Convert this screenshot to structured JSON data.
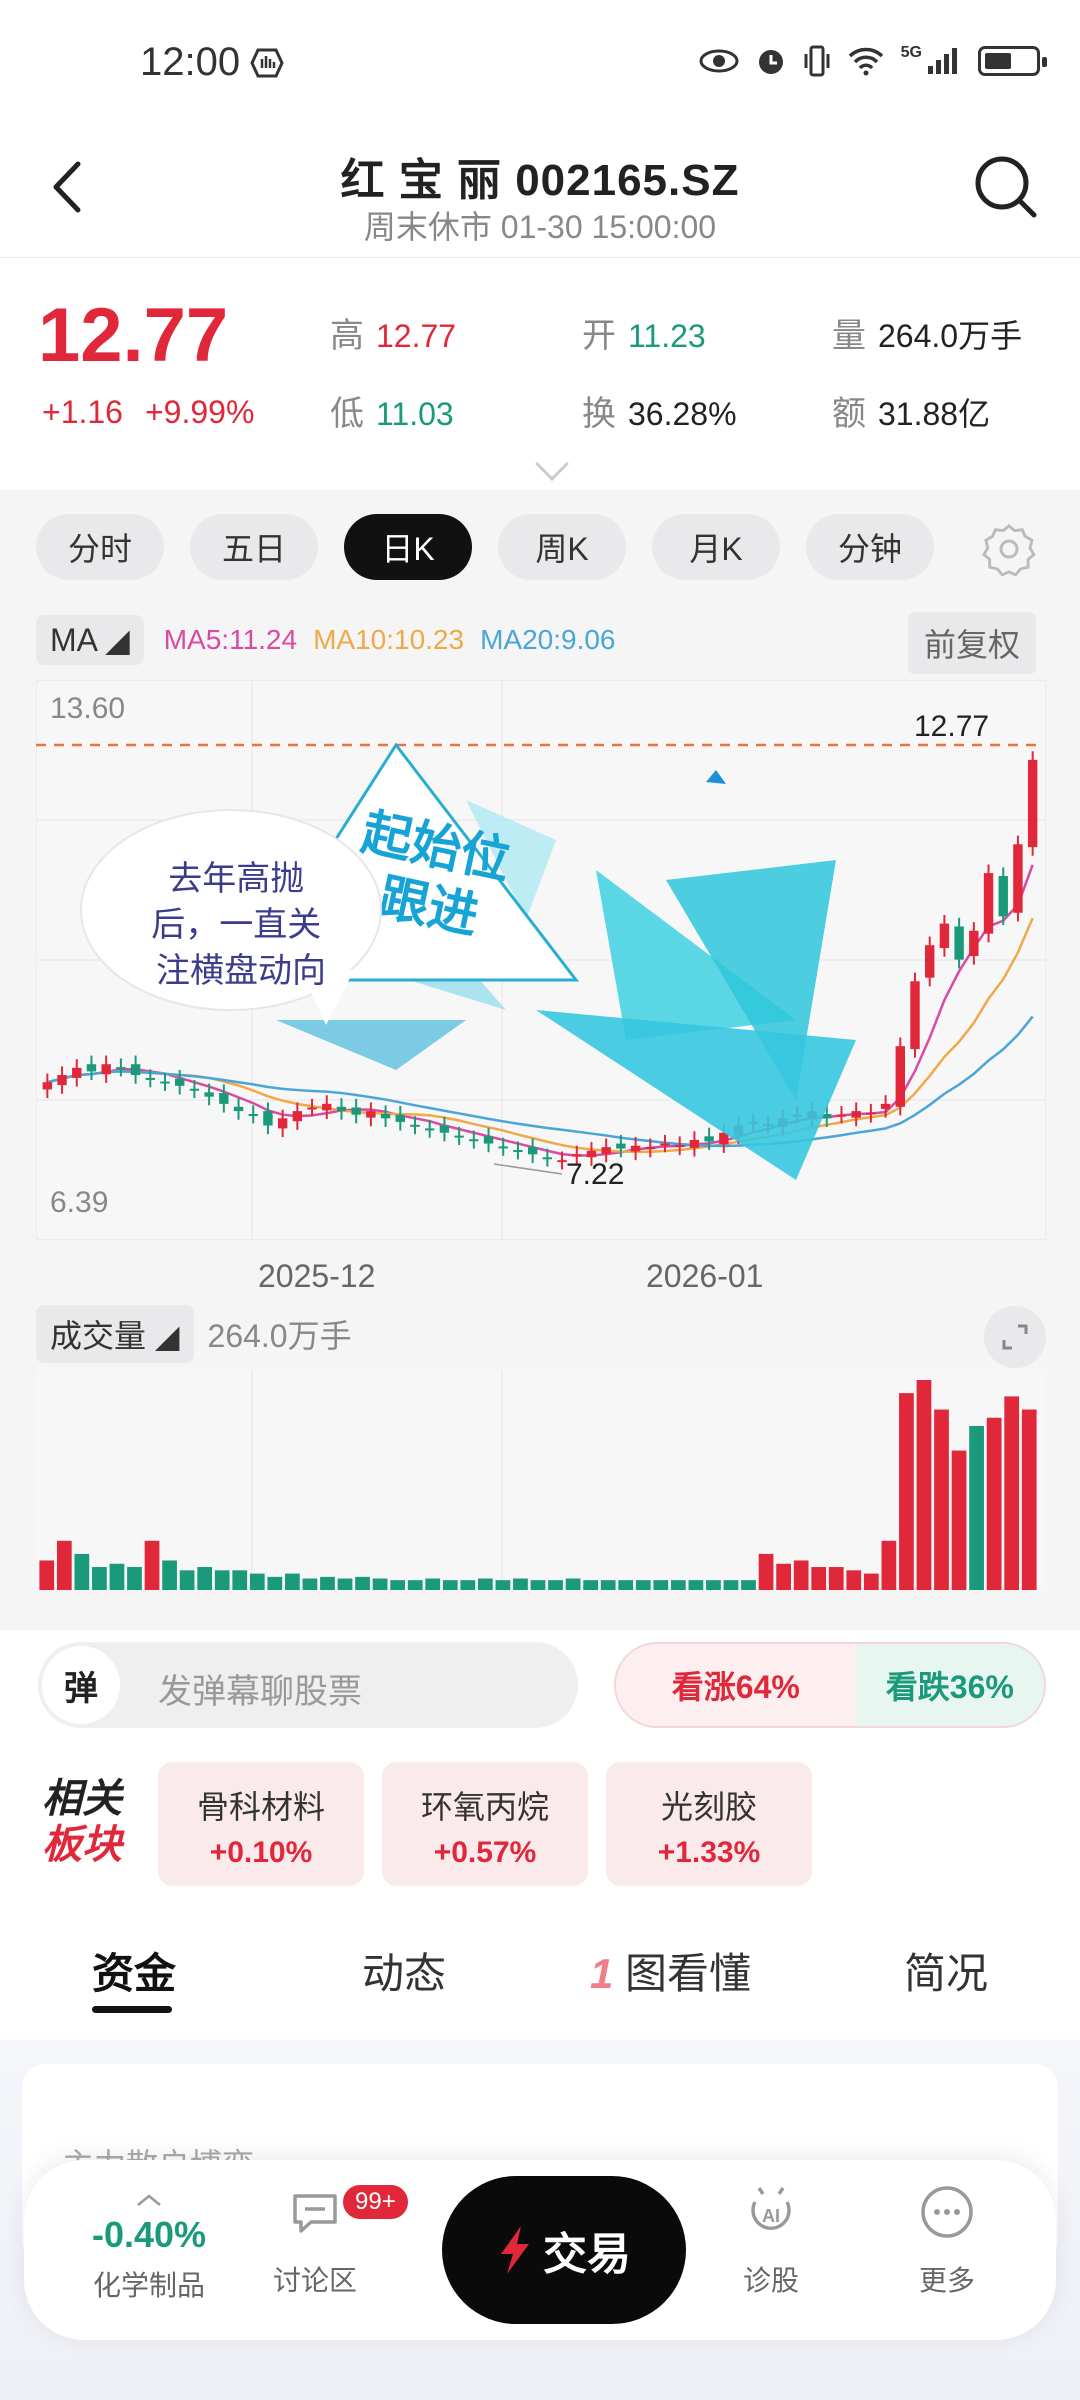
{
  "status_bar": {
    "time": "12:00",
    "net": "5G"
  },
  "header": {
    "title": "红 宝 丽 002165.SZ",
    "subtitle": "周末休市 01-30 15:00:00"
  },
  "quote": {
    "price": "12.77",
    "change": "+1.16",
    "change_pct": "+9.99%",
    "high_label": "高",
    "high": "12.77",
    "low_label": "低",
    "low": "11.03",
    "open_label": "开",
    "open": "11.23",
    "turnover_label": "换",
    "turnover": "36.28%",
    "volume_label": "量",
    "volume": "264.0万手",
    "amount_label": "额",
    "amount": "31.88亿"
  },
  "period_tabs": [
    "分时",
    "五日",
    "日K",
    "周K",
    "月K",
    "分钟"
  ],
  "active_tab": "日K",
  "indicators": {
    "ma_button": "MA",
    "ma5": "MA5:11.24",
    "ma10": "MA10:10.23",
    "ma20": "MA20:9.06",
    "adjust": "前复权"
  },
  "kline": {
    "price_high_label": "13.60",
    "price_low_label": "6.39",
    "last_price_label": "12.77",
    "min_marker_label": "7.22",
    "date_labels": [
      "2025-12",
      "2026-01"
    ]
  },
  "annotation": {
    "bubble": "去年高抛后，一直关注横盘动向",
    "sticker": "起始位跟进"
  },
  "volume": {
    "label": "成交量",
    "value": "264.0万手"
  },
  "danmu": {
    "tag": "弹",
    "placeholder": "发弹幕聊股票"
  },
  "sentiment": {
    "up": "看涨64%",
    "down": "看跌36%"
  },
  "related": {
    "title_a": "相关",
    "title_b": "板块",
    "items": [
      {
        "name": "骨科材料",
        "change": "+0.10%"
      },
      {
        "name": "环氧丙烷",
        "change": "+0.57%"
      },
      {
        "name": "光刻胶",
        "change": "+1.33%"
      }
    ]
  },
  "content_tabs": [
    "资金",
    "动态",
    "图看懂",
    "简况"
  ],
  "content_tab_badge": "1",
  "peek_text": "主力散户博弈",
  "bottom_nav": {
    "sector_pct": "-0.40%",
    "sector_name": "化学制品",
    "forum": "讨论区",
    "forum_badge": "99+",
    "trade": "交易",
    "diagnose": "诊股",
    "more": "更多"
  },
  "chart_data": [
    {
      "type": "candlestick",
      "title": "",
      "ylim": [
        6.39,
        13.6
      ],
      "x_labels": [
        "2025-12",
        "2026-01"
      ],
      "series": [
        {
          "name": "MA5",
          "values": []
        },
        {
          "name": "MA10",
          "values": []
        },
        {
          "name": "MA20",
          "values": []
        }
      ],
      "close": [
        8.3,
        8.4,
        8.5,
        8.45,
        8.55,
        8.5,
        8.4,
        8.35,
        8.3,
        8.25,
        8.2,
        8.1,
        8.0,
        7.9,
        7.85,
        7.7,
        7.8,
        7.9,
        7.95,
        8.0,
        7.9,
        7.85,
        7.9,
        7.8,
        7.75,
        7.7,
        7.65,
        7.6,
        7.55,
        7.5,
        7.45,
        7.4,
        7.35,
        7.3,
        7.25,
        7.22,
        7.3,
        7.35,
        7.4,
        7.38,
        7.42,
        7.4,
        7.45,
        7.43,
        7.5,
        7.48,
        7.6,
        7.7,
        7.75,
        7.72,
        7.8,
        7.85,
        7.9,
        7.8,
        7.85,
        7.9,
        7.88,
        8.0,
        8.8,
        9.7,
        10.2,
        10.5,
        10.0,
        10.4,
        11.2,
        10.6,
        11.6,
        12.77
      ]
    },
    {
      "type": "bar",
      "title": "",
      "values": [
        18,
        30,
        22,
        14,
        16,
        14,
        30,
        18,
        12,
        14,
        12,
        12,
        10,
        8,
        10,
        7,
        8,
        7,
        8,
        7,
        6,
        6,
        7,
        6,
        6,
        7,
        6,
        7,
        6,
        6,
        7,
        6,
        6,
        6,
        6,
        6,
        6,
        6,
        6,
        6,
        6,
        22,
        16,
        18,
        14,
        14,
        12,
        10,
        30,
        120,
        128,
        110,
        85,
        100,
        105,
        118,
        110
      ]
    }
  ]
}
